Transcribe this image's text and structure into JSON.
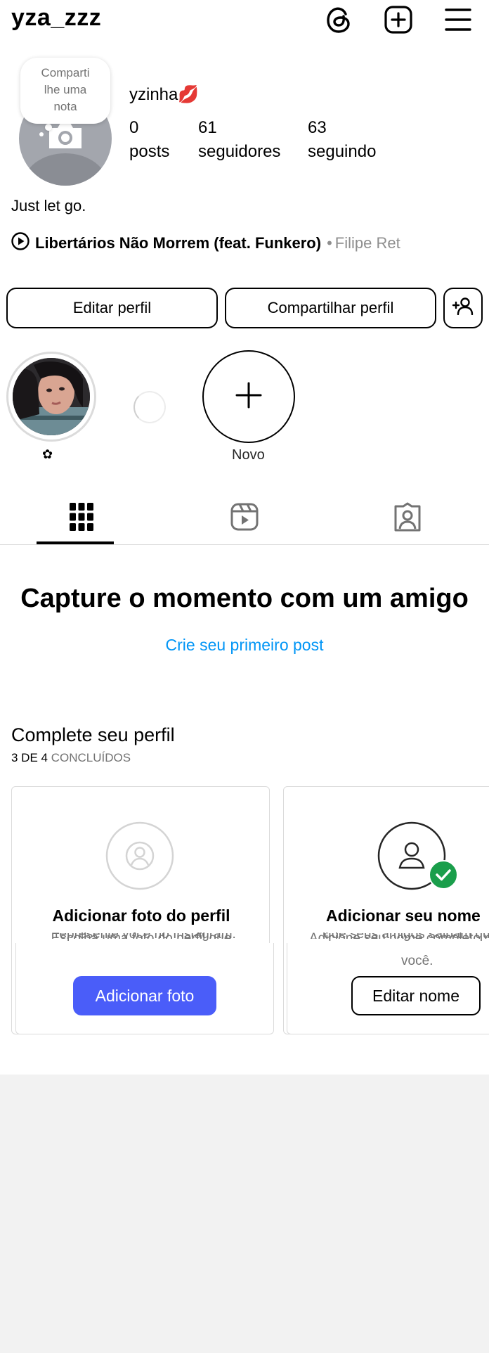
{
  "header": {
    "username": "yza_zzz",
    "icons": [
      "threads-icon",
      "plus-square-icon",
      "menu-icon"
    ]
  },
  "profile": {
    "note_bubble": "Compartilhe uma nota",
    "note_lines": [
      "Comparti",
      "lhe uma",
      "nota"
    ],
    "display_name": "yzinha💋",
    "stats": [
      {
        "value": "0",
        "label": "posts"
      },
      {
        "value": "61",
        "label": "seguidores"
      },
      {
        "value": "63",
        "label": "seguindo"
      }
    ],
    "bio": "Just let go.",
    "music": {
      "song": "Libertários Não Morrem (feat. Funkero)",
      "separator": "•",
      "artist": "Filipe Ret"
    }
  },
  "actions": {
    "edit_profile": "Editar perfil",
    "share_profile": "Compartilhar perfil"
  },
  "highlights": {
    "first_label": "✿",
    "new_label": "Novo"
  },
  "tabs": [
    "grid-icon",
    "reels-icon",
    "tagged-icon"
  ],
  "empty_state": {
    "title": "Capture o momento com um amigo",
    "link": "Crie seu primeiro post"
  },
  "complete_profile": {
    "title": "Complete seu perfil",
    "progress_count": "3 DE 4",
    "progress_word": "CONCLUÍDOS",
    "cards": [
      {
        "title": "Adicionar foto do perfil",
        "desc_top": "Escolha uma foto do perfil que",
        "desc_bottom": "represente você no Instagram.",
        "button": "Adicionar foto"
      },
      {
        "title": "Adicionar seu nome",
        "desc_top": "Adicione seu nome completo p",
        "desc_bottom_1": "que seus amigos saibam qu",
        "desc_bottom_2": "você.",
        "button": "Editar nome"
      }
    ]
  },
  "colors": {
    "link": "#0095f6",
    "primary_button": "#4a5df9",
    "check_badge": "#1a9e4b",
    "muted_text": "#737373"
  }
}
